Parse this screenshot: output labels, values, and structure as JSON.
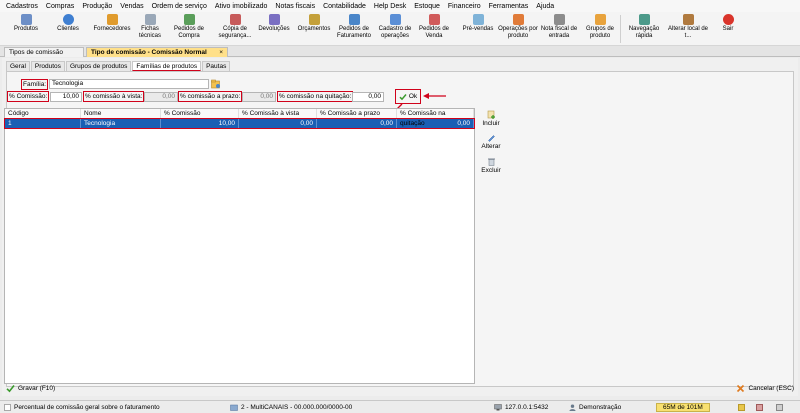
{
  "menu": [
    "Cadastros",
    "Compras",
    "Produção",
    "Vendas",
    "Ordem de serviço",
    "Ativo imobilizado",
    "Notas fiscais",
    "Contabilidade",
    "Help Desk",
    "Estoque",
    "Financeiro",
    "Ferramentas",
    "Ajuda"
  ],
  "toolbar": {
    "produtos": "Produtos",
    "clientes": "Clientes",
    "fornecedores": "Fornecedores",
    "fichas": "Fichas técnicas",
    "pedidos_compra": "Pedidos de Compra",
    "copia": "Cópia de segurança...",
    "devolucoes": "Devoluções",
    "orcamentos": "Orçamentos",
    "pedidos_faturamento": "Pedidos de Faturamento",
    "cadastro_operacoes": "Cadastro de operações",
    "pedidos_venda": "Pedidos de Venda",
    "pre_vendas": "Pré-vendas",
    "operacoes_produto": "Operações por produto",
    "nota_fiscal": "Nota fiscal de entrada",
    "grupos_produto": "Grupos de produto",
    "navegacao": "Navegação rápida",
    "alterar_local": "Alterar local de t...",
    "sair": "Sair"
  },
  "doc_tabs": {
    "tab1": "Tipos de comissão",
    "tab2": "Tipo de comissão - Comissão Normal",
    "close": "×"
  },
  "sub_tabs": [
    "Geral",
    "Produtos",
    "Grupos de produtos",
    "Famílias de produtos",
    "Pautas"
  ],
  "form": {
    "familia_label": "Família:",
    "familia_value": "Tecnologia",
    "comissao_label": "% Comissão:",
    "comissao_value": "10,00",
    "avista_label": "% comissão à vista:",
    "avista_value": "0,00",
    "prazo_label": "% comissão a prazo:",
    "prazo_value": "0,00",
    "quitacao_label": "% comissão na quitação:",
    "quitacao_value": "0,00",
    "ok_label": "Ok"
  },
  "grid": {
    "headers": [
      "Código",
      "Nome",
      "% Comissão",
      "% Comissão à vista",
      "% Comissão a prazo",
      "% Comissão na quitação"
    ],
    "row": [
      "1",
      "Tecnologia",
      "10,00",
      "0,00",
      "0,00",
      "0,00"
    ]
  },
  "side_actions": {
    "incluir": "Incluir",
    "alterar": "Alterar",
    "excluir": "Excluir"
  },
  "footer": {
    "gravar": "Gravar (F10)",
    "cancelar": "Cancelar (ESC)"
  },
  "status": {
    "hint": "Percentual de comissão geral sobre o faturamento",
    "company": "2 - MultiCANAIS - 00.000.000/0000-00",
    "server": "127.0.0.1:5432",
    "user": "Demonstração",
    "memory": "65M de 101M"
  },
  "colors": {
    "highlight_red": "#d0021b",
    "selection_blue": "#1a5fb4",
    "active_tab": "#ffe08a",
    "memory_bar": "#f8e070"
  }
}
